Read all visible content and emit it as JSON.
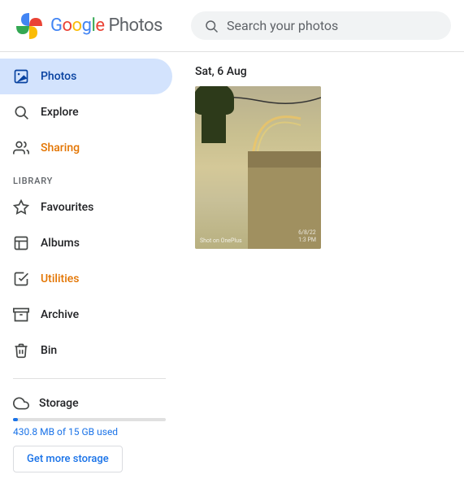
{
  "header": {
    "logo_text_google": "Google",
    "logo_text_photos": "Photos",
    "search_placeholder": "Search your photos"
  },
  "sidebar": {
    "section_library": "LIBRARY",
    "nav_items": [
      {
        "id": "photos",
        "label": "Photos",
        "active": true
      },
      {
        "id": "explore",
        "label": "Explore",
        "active": false
      },
      {
        "id": "sharing",
        "label": "Sharing",
        "active": false,
        "highlight": true
      }
    ],
    "library_items": [
      {
        "id": "favourites",
        "label": "Favourites"
      },
      {
        "id": "albums",
        "label": "Albums"
      },
      {
        "id": "utilities",
        "label": "Utilities",
        "highlight": true
      },
      {
        "id": "archive",
        "label": "Archive"
      },
      {
        "id": "bin",
        "label": "Bin"
      }
    ],
    "storage": {
      "label": "Storage",
      "used_text": "430.8 MB of 15 GB used",
      "used_percent": 3,
      "get_more_label": "Get more storage"
    }
  },
  "main": {
    "date_header": "Sat, 6 Aug",
    "photos": [
      {
        "watermark": "Shot on OnePlus",
        "timestamp": "6/8/22\n1:3 PM"
      }
    ]
  }
}
